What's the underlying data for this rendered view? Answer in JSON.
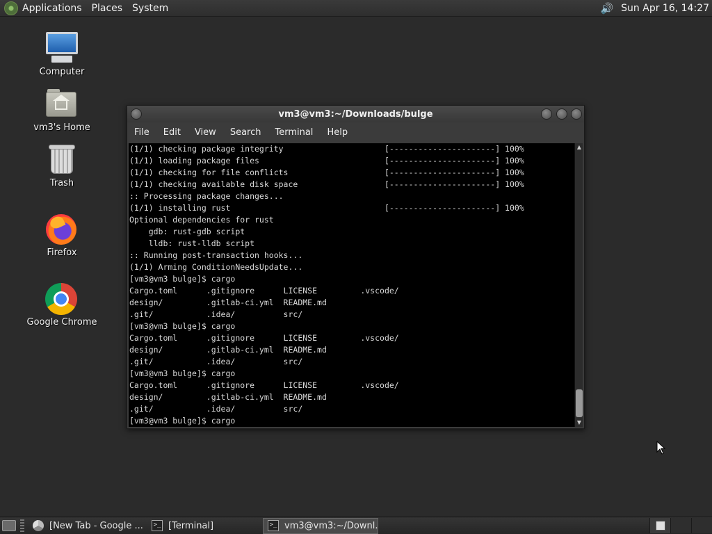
{
  "top_panel": {
    "menus": [
      "Applications",
      "Places",
      "System"
    ],
    "clock": "Sun Apr 16, 14:27",
    "volume_icon": "volume-icon"
  },
  "desktop_icons": [
    {
      "label": "Computer",
      "icon": "computer-icon"
    },
    {
      "label": "vm3's Home",
      "icon": "home-folder-icon"
    },
    {
      "label": "Trash",
      "icon": "trash-icon"
    },
    {
      "label": "Firefox",
      "icon": "firefox-icon"
    },
    {
      "label": "Google Chrome",
      "icon": "chrome-icon"
    }
  ],
  "terminal_window": {
    "title": "vm3@vm3:~/Downloads/bulge",
    "menu": [
      "File",
      "Edit",
      "View",
      "Search",
      "Terminal",
      "Help"
    ],
    "lines": [
      "(1/1) checking package integrity                     [----------------------] 100%",
      "(1/1) loading package files                          [----------------------] 100%",
      "(1/1) checking for file conflicts                    [----------------------] 100%",
      "(1/1) checking available disk space                  [----------------------] 100%",
      ":: Processing package changes...",
      "(1/1) installing rust                                [----------------------] 100%",
      "Optional dependencies for rust",
      "    gdb: rust-gdb script",
      "    lldb: rust-lldb script",
      ":: Running post-transaction hooks...",
      "(1/1) Arming ConditionNeedsUpdate...",
      "[vm3@vm3 bulge]$ cargo",
      "Cargo.toml      .gitignore      LICENSE         .vscode/",
      "design/         .gitlab-ci.yml  README.md",
      ".git/           .idea/          src/",
      "[vm3@vm3 bulge]$ cargo",
      "Cargo.toml      .gitignore      LICENSE         .vscode/",
      "design/         .gitlab-ci.yml  README.md",
      ".git/           .idea/          src/",
      "[vm3@vm3 bulge]$ cargo",
      "Cargo.toml      .gitignore      LICENSE         .vscode/",
      "design/         .gitlab-ci.yml  README.md",
      ".git/           .idea/          src/",
      "[vm3@vm3 bulge]$ cargo"
    ]
  },
  "taskbar": {
    "tasks": [
      {
        "label": "[New Tab - Google ...",
        "icon": "chrome-icon",
        "active": false
      },
      {
        "label": "[Terminal]",
        "icon": "terminal-icon",
        "active": false
      },
      {
        "label": "vm3@vm3:~/Downl...",
        "icon": "terminal-icon",
        "active": true
      }
    ]
  }
}
